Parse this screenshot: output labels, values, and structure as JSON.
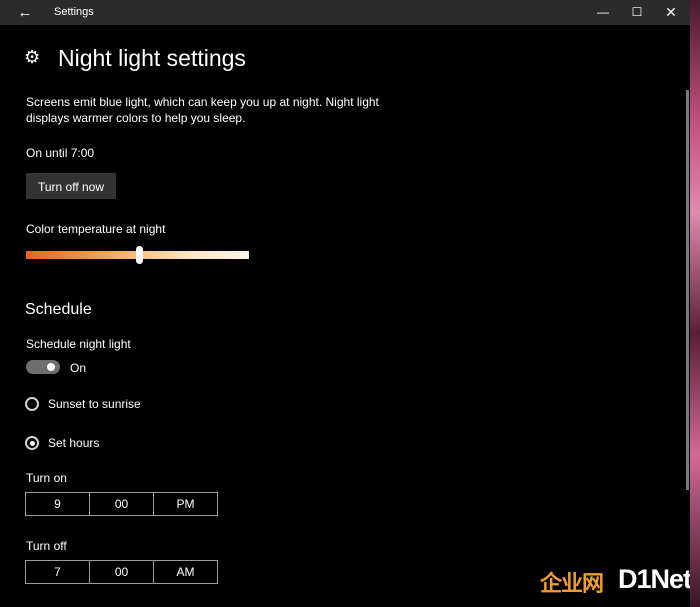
{
  "window": {
    "title": "Settings",
    "back_glyph": "←",
    "minimize_glyph": "—",
    "maximize_glyph": "☐",
    "close_glyph": "✕"
  },
  "page": {
    "title": "Night light settings",
    "icon": "gear-icon",
    "icon_glyph": "⚙",
    "description": "Screens emit blue light, which can keep you up at night. Night light displays warmer colors to help you sleep.",
    "status": "On until 7:00",
    "turn_off_button": "Turn off now"
  },
  "color_temperature": {
    "label": "Color temperature at night",
    "value_fraction": 0.51,
    "gradient_start": "#e8641a",
    "gradient_end": "#fff6ea"
  },
  "schedule": {
    "heading": "Schedule",
    "toggle_label": "Schedule night light",
    "toggle_state": "On",
    "toggle_on": true,
    "options": [
      {
        "label": "Sunset to sunrise",
        "selected": false
      },
      {
        "label": "Set hours",
        "selected": true
      }
    ],
    "turn_on": {
      "label": "Turn on",
      "hour": "9",
      "minute": "00",
      "period": "PM"
    },
    "turn_off": {
      "label": "Turn off",
      "hour": "7",
      "minute": "00",
      "period": "AM"
    }
  },
  "watermark": {
    "cn": "企业网",
    "en": "D1Net"
  }
}
